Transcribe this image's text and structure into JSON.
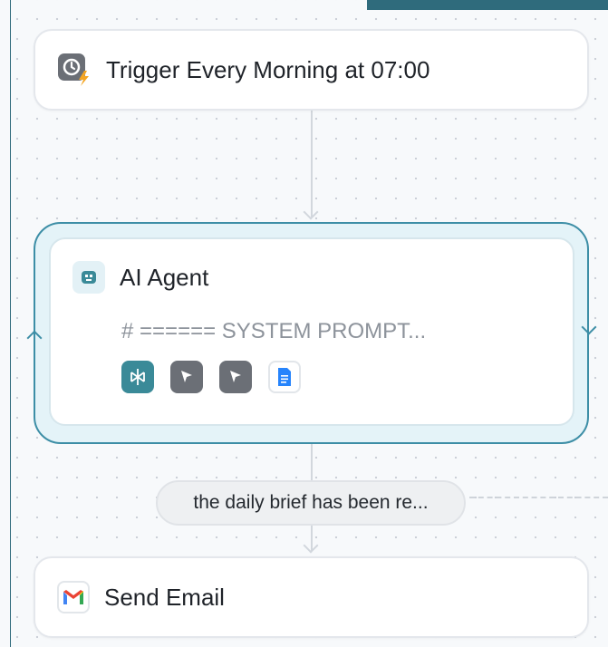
{
  "trigger": {
    "title": "Trigger Every Morning at 07:00",
    "icon": "clock-bolt-icon"
  },
  "agent": {
    "title": "AI Agent",
    "prompt_preview": "# ====== SYSTEM PROMPT...",
    "icon": "robot-icon",
    "tools": [
      "perplexity-tool-icon",
      "cursor-tool-icon",
      "cursor-tool-icon",
      "google-docs-icon"
    ]
  },
  "condition": {
    "label": "the daily brief has been re..."
  },
  "email": {
    "title": "Send Email",
    "icon": "gmail-icon"
  },
  "colors": {
    "accent": "#3d8ea6",
    "loop_fill": "#e4f3f8",
    "topbar": "#2f6b7c",
    "bolt": "#f5a623"
  }
}
